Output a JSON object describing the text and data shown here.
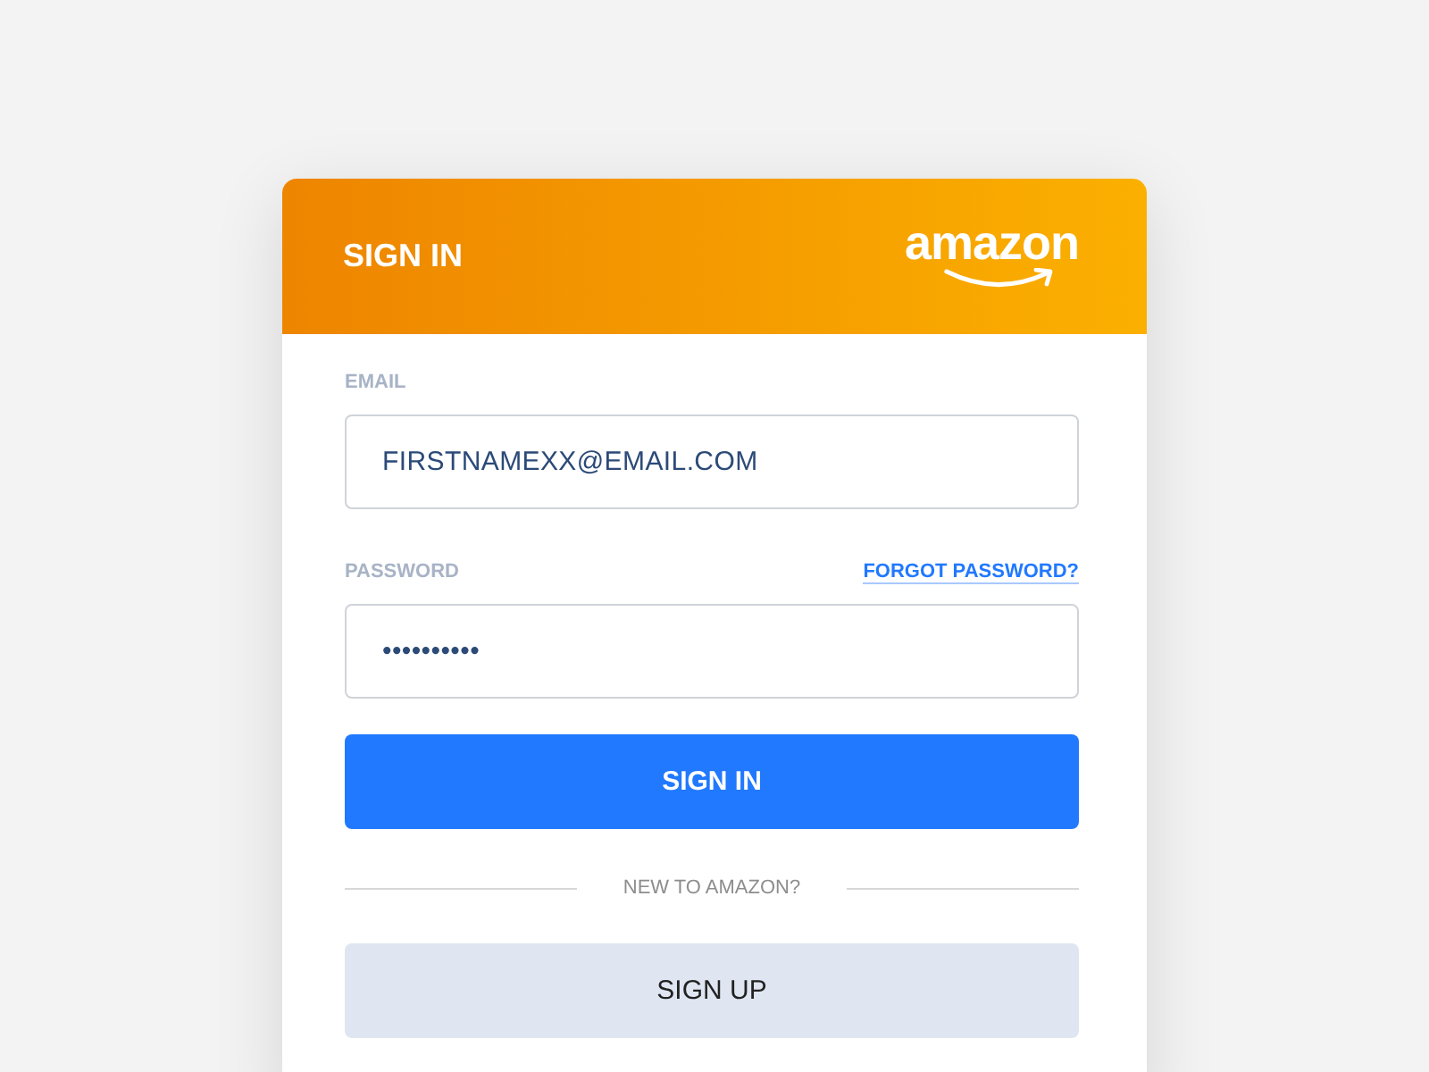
{
  "header": {
    "title": "SIGN IN",
    "logo": "amazon"
  },
  "fields": [
    {
      "label": "EMAIL",
      "value": "FIRSTNAMEXX@EMAIL.COM"
    },
    {
      "label": "PASSWORD",
      "value": "••••••••••",
      "link": "FORGOT PASSWORD?"
    }
  ],
  "primary_button": "SIGN IN",
  "divider_text": "NEW TO AMAZON?",
  "secondary_button": "SIGN UP"
}
